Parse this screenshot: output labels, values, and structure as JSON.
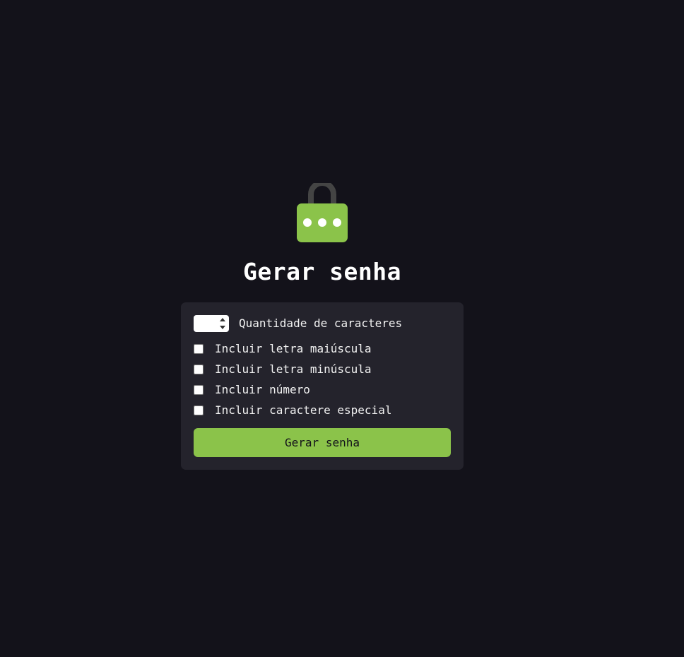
{
  "page": {
    "title": "Gerar senha",
    "icon": "lock-icon"
  },
  "form": {
    "quantity": {
      "value": "",
      "label": "Quantidade de caracteres"
    },
    "options": [
      {
        "label": "Incluir letra maiúscula",
        "checked": false
      },
      {
        "label": "Incluir letra minúscula",
        "checked": false
      },
      {
        "label": "Incluir número",
        "checked": false
      },
      {
        "label": "Incluir caractere especial",
        "checked": false
      }
    ],
    "submit_label": "Gerar senha"
  },
  "colors": {
    "background": "#13121a",
    "card": "#24232c",
    "accent": "#8bc34a",
    "lock_shackle": "#444444"
  }
}
